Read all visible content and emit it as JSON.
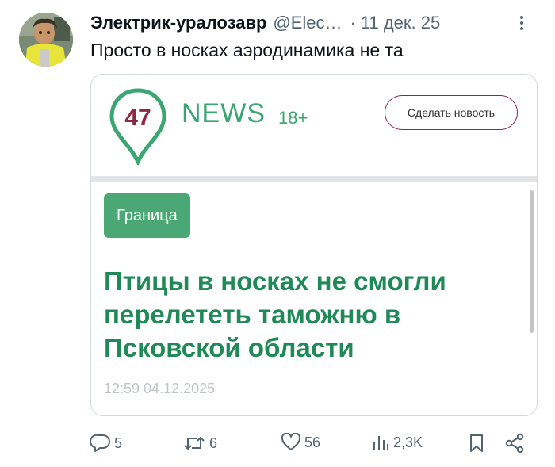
{
  "tweet": {
    "author_name": "Электрик-уралозавр",
    "handle": "@Elec…",
    "separator": "·",
    "time": "11 дек. 25",
    "text": "Просто в носках аэродинамика не та"
  },
  "card": {
    "logo_number": "47",
    "logo_word": "NEWS",
    "age_rating": "18+",
    "make_news_label": "Сделать новость",
    "tag": "Граница",
    "headline": "Птицы в носках не смогли перелететь таможню в Псковской области",
    "datetime": "12:59 04.12.2025",
    "brand_colors": {
      "green": "#3aa672",
      "maroon": "#8b2a45",
      "headline": "#1f8a57"
    }
  },
  "actions": {
    "replies": "5",
    "reposts": "6",
    "likes": "56",
    "views": "2,3K"
  },
  "icons": [
    "more-icon",
    "reply-icon",
    "repost-icon",
    "like-icon",
    "views-icon",
    "bookmark-icon",
    "share-icon"
  ]
}
